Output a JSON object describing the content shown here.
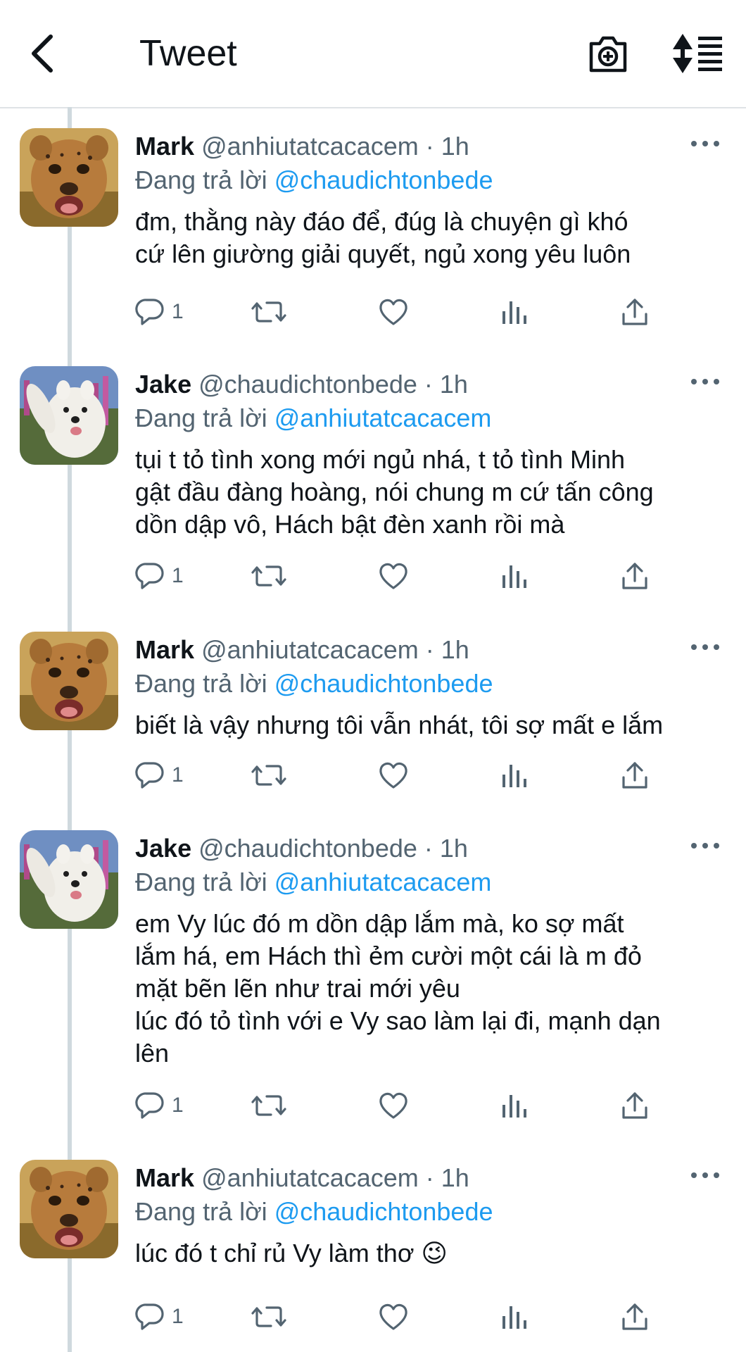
{
  "header": {
    "title": "Tweet",
    "back_icon": "chevron-left-icon",
    "camera_icon": "add-photo-camera-icon",
    "sort_icon": "sort-list-icon"
  },
  "colors": {
    "link": "#1d9bf0",
    "secondary": "#536471",
    "thread_line": "#cfd9de"
  },
  "tweets": [
    {
      "name": "Mark",
      "handle_time": "@anhiutatcacacem · 1h",
      "reply_prefix": "Đang trả lời",
      "reply_to": "@chaudichtonbede",
      "lines": [
        "đm, thằng này đáo để, đúg là chuyện gì khó",
        "cứ lên giường giải quyết, ngủ xong yêu luôn"
      ],
      "reply_count": "1",
      "avatar": "cheetah-cub"
    },
    {
      "name": "Jake",
      "handle_time": "@chaudichtonbede · 1h",
      "reply_prefix": "Đang trả lời",
      "reply_to": "@anhiutatcacacem",
      "lines": [
        "tụi t tỏ tình xong mới ngủ nhá, t tỏ tình Minh",
        "gật đầu đàng hoàng, nói chung m cứ tấn công",
        "dồn dập vô, Hách bật đèn xanh rồi mà"
      ],
      "reply_count": "1",
      "avatar": "samoyed-dog"
    },
    {
      "name": "Mark",
      "handle_time": "@anhiutatcacacem · 1h",
      "reply_prefix": "Đang trả lời",
      "reply_to": "@chaudichtonbede",
      "lines": [
        "biết là vậy nhưng tôi vẫn nhát, tôi sợ mất e lắm"
      ],
      "reply_count": "1",
      "avatar": "cheetah-cub"
    },
    {
      "name": "Jake",
      "handle_time": "@chaudichtonbede · 1h",
      "reply_prefix": "Đang trả lời",
      "reply_to": "@anhiutatcacacem",
      "lines": [
        "em Vy lúc đó m dồn dập lắm mà, ko sợ mất",
        "lắm há, em Hách thì ẻm cười một cái là m đỏ",
        "mặt bẽn lẽn như trai mới yêu",
        "lúc đó tỏ tình với e Vy sao làm lại đi, mạnh dạn",
        "lên"
      ],
      "reply_count": "1",
      "avatar": "samoyed-dog"
    },
    {
      "name": "Mark",
      "handle_time": "@anhiutatcacacem · 1h",
      "reply_prefix": "Đang trả lời",
      "reply_to": "@chaudichtonbede",
      "lines": [
        "lúc đó t chỉ rủ Vy làm thơ 😉"
      ],
      "reply_count": "1",
      "avatar": "cheetah-cub"
    }
  ]
}
